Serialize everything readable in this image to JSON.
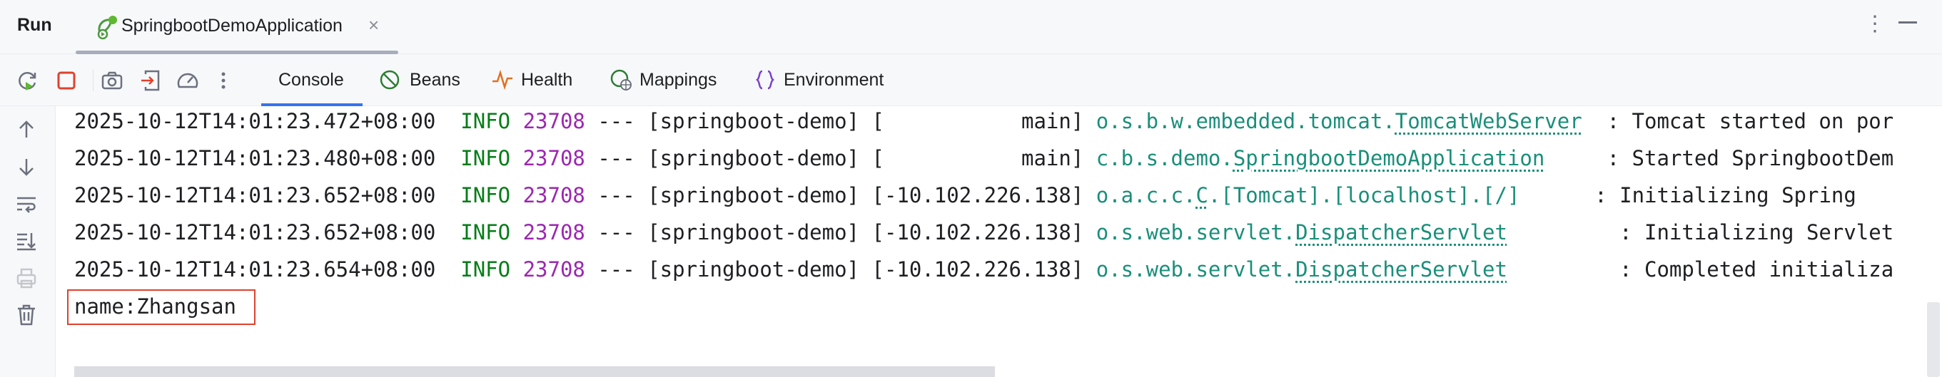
{
  "titlebar": {
    "title": "Run",
    "run_tab": {
      "label": "SpringbootDemoApplication",
      "close": "×"
    }
  },
  "toolbar": {
    "icons": [
      "rerun-icon",
      "stop-icon",
      "camera-icon",
      "exit-icon",
      "speedometer-icon",
      "more-vertical-icon"
    ],
    "tabs": [
      {
        "label": "Console",
        "icon": "console",
        "active": true
      },
      {
        "label": "Beans",
        "icon": "bean-icon",
        "active": false
      },
      {
        "label": "Health",
        "icon": "pulse-icon",
        "active": false
      },
      {
        "label": "Mappings",
        "icon": "globe-map-icon",
        "active": false
      },
      {
        "label": "Environment",
        "icon": "braces-icon",
        "active": false
      }
    ]
  },
  "colors": {
    "info": "#067d17",
    "pid": "#9c27b0",
    "logger": "#1a8f7a",
    "stop": "#e0412c",
    "accent": "#3574f0"
  },
  "console": {
    "lines": [
      {
        "ts": "2025-10-12T14:01:23.472+08:00",
        "level": "INFO",
        "pid": "23708",
        "sep": "---",
        "app": "[springboot-demo]",
        "thread": "[           main]",
        "logger_pkg": "o.s.b.w.embedded.tomcat.",
        "logger_cls": "TomcatWebServer",
        "pad": "  ",
        "message": ": Tomcat started on por"
      },
      {
        "ts": "2025-10-12T14:01:23.480+08:00",
        "level": "INFO",
        "pid": "23708",
        "sep": "---",
        "app": "[springboot-demo]",
        "thread": "[           main]",
        "logger_pkg": "c.b.s.demo.",
        "logger_cls": "SpringbootDemoApplication",
        "pad": "     ",
        "message": ": Started SpringbootDem"
      },
      {
        "ts": "2025-10-12T14:01:23.652+08:00",
        "level": "INFO",
        "pid": "23708",
        "sep": "---",
        "app": "[springboot-demo]",
        "thread": "[-10.102.226.138]",
        "logger_pkg": "o.a.c.c.",
        "logger_cls": "C",
        "logger_tail": ".[Tomcat].[localhost].[/]",
        "pad": "      ",
        "message": ": Initializing Spring "
      },
      {
        "ts": "2025-10-12T14:01:23.652+08:00",
        "level": "INFO",
        "pid": "23708",
        "sep": "---",
        "app": "[springboot-demo]",
        "thread": "[-10.102.226.138]",
        "logger_pkg": "o.s.web.servlet.",
        "logger_cls": "DispatcherServlet",
        "pad": "         ",
        "message": ": Initializing Servlet"
      },
      {
        "ts": "2025-10-12T14:01:23.654+08:00",
        "level": "INFO",
        "pid": "23708",
        "sep": "---",
        "app": "[springboot-demo]",
        "thread": "[-10.102.226.138]",
        "logger_pkg": "o.s.web.servlet.",
        "logger_cls": "DispatcherServlet",
        "pad": "         ",
        "message": ": Completed initializa"
      }
    ],
    "output_line": "name:Zhangsan"
  }
}
